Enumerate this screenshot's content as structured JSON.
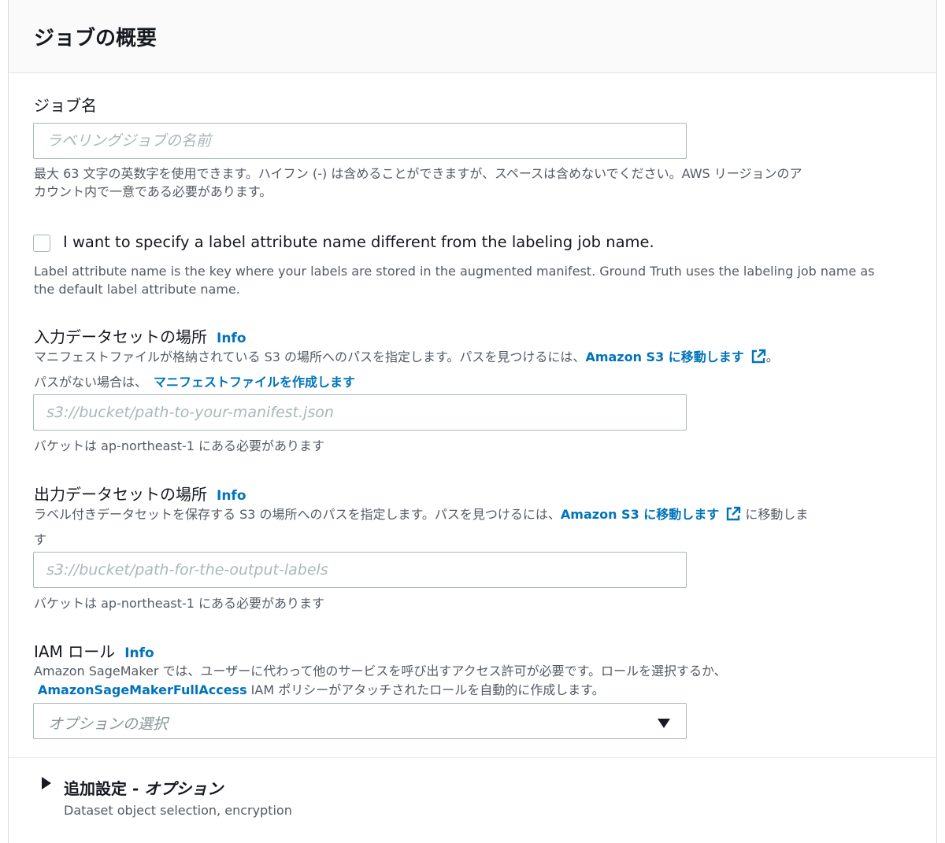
{
  "panel": {
    "title": "ジョブの概要"
  },
  "job_name": {
    "label": "ジョブ名",
    "placeholder": "ラベリングジョブの名前",
    "hint_line1": "最大 63 文字の英数字を使用できます。ハイフン (-) は含めることができますが、スペースは含めないでください。AWS リージョンのア",
    "hint_line2": "カウント内で一意である必要があります。"
  },
  "label_attr": {
    "checkbox_label": "I want to specify a label attribute name different from the labeling job name.",
    "checked": false,
    "desc_line1": "Label attribute name is the key where your labels are stored in the augmented manifest. Ground Truth uses the labeling job name as",
    "desc_line2": "the default label attribute name."
  },
  "input_location": {
    "label": "入力データセットの場所",
    "info": "Info",
    "desc_prefix": "マニフェストファイルが格納されている S3 の場所へのパスを指定します。パスを見つけるには、",
    "desc_link": "Amazon S3 に移動します",
    "desc_suffix": "。",
    "desc2_prefix": "パスがない場合は、",
    "desc2_link": "マニフェストファイルを作成します",
    "placeholder": "s3://bucket/path-to-your-manifest.json",
    "hint": "バケットは ap-northeast-1 にある必要があります"
  },
  "output_location": {
    "label": "出力データセットの場所",
    "info": "Info",
    "desc_prefix": "ラベル付きデータセットを保存する S3 の場所へのパスを指定します。パスを見つけるには、",
    "desc_link": "Amazon S3 に移動します",
    "desc_suffix": " に移動しま",
    "desc_line2": "す",
    "placeholder": "s3://bucket/path-for-the-output-labels",
    "hint": "バケットは ap-northeast-1 にある必要があります"
  },
  "iam_role": {
    "label": "IAM ロール",
    "info": "Info",
    "desc_line1": "Amazon SageMaker では、ユーザーに代わって他のサービスを呼び出すアクセス許可が必要です。ロールを選択するか、",
    "desc_link": "AmazonSageMakerFullAccess",
    "desc_line2_suffix": " IAM ポリシーがアタッチされたロールを自動的に作成します。",
    "select_placeholder": "オプションの選択"
  },
  "additional": {
    "title_prefix": "追加設定 - ",
    "title_italic": "オプション",
    "subtitle": "Dataset object selection, encryption"
  },
  "colors": {
    "link": "#0073bb",
    "border": "#aab7b8",
    "muted": "#545b64"
  },
  "icons": [
    "external-link-icon",
    "caret-down-icon",
    "caret-right-icon"
  ]
}
